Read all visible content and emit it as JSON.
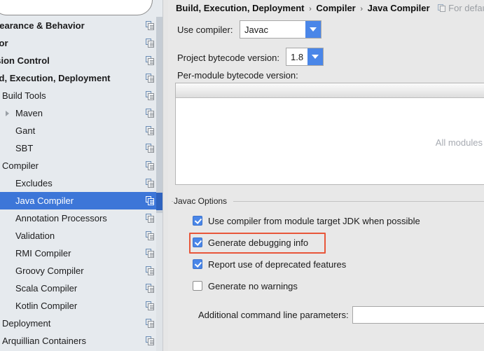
{
  "sidebar": {
    "search": {
      "value": "",
      "placeholder": ""
    },
    "items": [
      {
        "label": "Appearance & Behavior",
        "indent": -26,
        "bold": true,
        "arrow": false,
        "selected": false,
        "icon": "copy-icon"
      },
      {
        "label": "Editor",
        "indent": -26,
        "bold": true,
        "arrow": false,
        "selected": false,
        "icon": "copy-icon"
      },
      {
        "label": "Version Control",
        "indent": -26,
        "bold": true,
        "arrow": false,
        "selected": false,
        "icon": "copy-icon"
      },
      {
        "label": "Build, Execution, Deployment",
        "indent": -26,
        "bold": true,
        "arrow": false,
        "selected": false,
        "icon": "copy-icon"
      },
      {
        "label": "Build Tools",
        "indent": 3,
        "bold": false,
        "arrow": false,
        "selected": false,
        "icon": "copy-icon"
      },
      {
        "label": "Maven",
        "indent": 22,
        "bold": false,
        "arrow": true,
        "selected": false,
        "icon": "copy-icon"
      },
      {
        "label": "Gant",
        "indent": 22,
        "bold": false,
        "arrow": false,
        "selected": false,
        "icon": "copy-icon"
      },
      {
        "label": "SBT",
        "indent": 22,
        "bold": false,
        "arrow": false,
        "selected": false,
        "icon": "copy-icon"
      },
      {
        "label": "Compiler",
        "indent": 3,
        "bold": false,
        "arrow": false,
        "selected": false,
        "icon": "copy-icon"
      },
      {
        "label": "Excludes",
        "indent": 22,
        "bold": false,
        "arrow": false,
        "selected": false,
        "icon": "copy-icon"
      },
      {
        "label": "Java Compiler",
        "indent": 22,
        "bold": false,
        "arrow": false,
        "selected": true,
        "icon": "copy-icon"
      },
      {
        "label": "Annotation Processors",
        "indent": 22,
        "bold": false,
        "arrow": false,
        "selected": false,
        "icon": "copy-icon"
      },
      {
        "label": "Validation",
        "indent": 22,
        "bold": false,
        "arrow": false,
        "selected": false,
        "icon": "copy-icon"
      },
      {
        "label": "RMI Compiler",
        "indent": 22,
        "bold": false,
        "arrow": false,
        "selected": false,
        "icon": "copy-icon"
      },
      {
        "label": "Groovy Compiler",
        "indent": 22,
        "bold": false,
        "arrow": false,
        "selected": false,
        "icon": "copy-icon"
      },
      {
        "label": "Scala Compiler",
        "indent": 22,
        "bold": false,
        "arrow": false,
        "selected": false,
        "icon": "copy-icon"
      },
      {
        "label": "Kotlin Compiler",
        "indent": 22,
        "bold": false,
        "arrow": false,
        "selected": false,
        "icon": "copy-icon"
      },
      {
        "label": "Deployment",
        "indent": 3,
        "bold": false,
        "arrow": false,
        "selected": false,
        "icon": "copy-icon"
      },
      {
        "label": "Arquillian Containers",
        "indent": 3,
        "bold": false,
        "arrow": false,
        "selected": false,
        "icon": "copy-icon"
      }
    ]
  },
  "main": {
    "breadcrumb": {
      "part1": "Build, Execution, Deployment",
      "sep1": "›",
      "part2": "Compiler",
      "sep2": "›",
      "part3": "Java Compiler",
      "note": "For default"
    },
    "use_compiler": {
      "label": "Use compiler:",
      "value": "Javac"
    },
    "project_bytecode": {
      "label": "Project bytecode version:",
      "value": "1.8"
    },
    "per_module": {
      "label": "Per-module bytecode version:",
      "empty_text": "All modules"
    },
    "javac_options": {
      "title": "Javac Options",
      "checkboxes": [
        {
          "label": "Use compiler from module target JDK when possible",
          "checked": true,
          "highlighted": false
        },
        {
          "label": "Generate debugging info",
          "checked": true,
          "highlighted": true
        },
        {
          "label": "Report use of deprecated features",
          "checked": true,
          "highlighted": false
        },
        {
          "label": "Generate no warnings",
          "checked": false,
          "highlighted": false
        }
      ],
      "additional_params": {
        "label": "Additional command line parameters:",
        "value": "",
        "placeholder": ""
      }
    }
  },
  "colors": {
    "selection_blue": "#3d76d8",
    "accent_blue": "#4a86e8",
    "highlight_red": "#e8563a",
    "sidebar_bg": "#e6eaee",
    "panel_bg": "#e8e8e8"
  }
}
